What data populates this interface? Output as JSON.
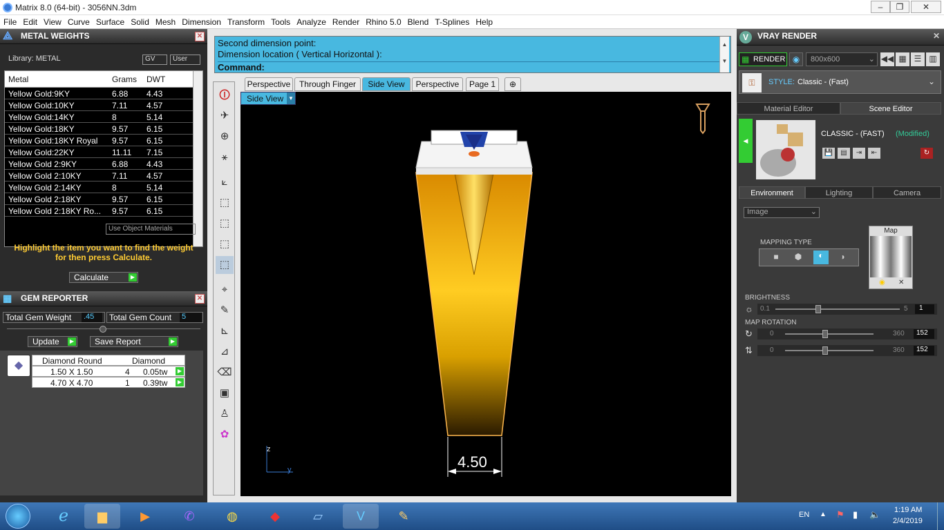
{
  "window": {
    "title": "Matrix 8.0 (64-bit) - 3056NN.3dm"
  },
  "menu": [
    "File",
    "Edit",
    "View",
    "Curve",
    "Surface",
    "Solid",
    "Mesh",
    "Dimension",
    "Transform",
    "Tools",
    "Analyze",
    "Render",
    "Rhino 5.0",
    "Blend",
    "T-Splines",
    "Help"
  ],
  "metal": {
    "title": "METAL WEIGHTS",
    "library": "Library: METAL",
    "gv": "GV",
    "user": "User",
    "headers": [
      "Metal",
      "Grams",
      "DWT"
    ],
    "rows": [
      [
        "Yellow Gold:9KY",
        "6.88",
        "4.43"
      ],
      [
        "Yellow Gold:10KY",
        "7.11",
        "4.57"
      ],
      [
        "Yellow Gold:14KY",
        "8",
        "5.14"
      ],
      [
        "Yellow Gold:18KY",
        "9.57",
        "6.15"
      ],
      [
        "Yellow Gold:18KY Royal",
        "9.57",
        "6.15"
      ],
      [
        "Yellow Gold:22KY",
        "11.11",
        "7.15"
      ],
      [
        "Yellow Gold 2:9KY",
        "6.88",
        "4.43"
      ],
      [
        "Yellow Gold 2:10KY",
        "7.11",
        "4.57"
      ],
      [
        "Yellow Gold 2:14KY",
        "8",
        "5.14"
      ],
      [
        "Yellow Gold 2:18KY",
        "9.57",
        "6.15"
      ],
      [
        "Yellow Gold 2:18KY Ro...",
        "9.57",
        "6.15"
      ]
    ],
    "use_object": "Use Object Materials",
    "hint": "Highlight the item you want to find the weight for then press Calculate.",
    "calculate": "Calculate"
  },
  "gem": {
    "title": "GEM REPORTER",
    "total_weight_label": "Total Gem Weight",
    "total_weight": ".45",
    "total_count_label": "Total Gem Count",
    "total_count": "5",
    "update": "Update",
    "save_report": "Save Report",
    "headers": [
      "Diamond Round",
      "Diamond"
    ],
    "rows": [
      [
        "1.50 X 1.50",
        "4",
        "0.05tw"
      ],
      [
        "4.70 X 4.70",
        "1",
        "0.39tw"
      ]
    ]
  },
  "command": {
    "line1": "Second dimension point:",
    "line2": "Dimension location ( Vertical  Horizontal ):",
    "prompt": "Command:"
  },
  "viewtabs": [
    "Perspective",
    "Through Finger",
    "Side View",
    "Perspective",
    "Page 1"
  ],
  "viewport": {
    "label": "Side View",
    "dimension": "4.50",
    "axis_z": "z",
    "axis_y": "y"
  },
  "vray": {
    "title": "VRAY RENDER",
    "render": "RENDER",
    "resolution": "800x600",
    "style_label": "STYLE:",
    "style_value": "Classic - (Fast)",
    "tabs": [
      "Material Editor",
      "Scene Editor"
    ],
    "preset": "CLASSIC - (FAST)",
    "modified": "(Modified)",
    "env_tabs": [
      "Environment",
      "Lighting",
      "Camera"
    ],
    "env_type": "Image",
    "mapping_type": "MAPPING TYPE",
    "map": "Map",
    "brightness": "BRIGHTNESS",
    "b_min": "0.1",
    "b_max": "5",
    "b_val": "1",
    "b_level": 0.32,
    "map_rotation": "MAP ROTATION",
    "r_min": "0",
    "r_max": "360",
    "r1_val": "152",
    "r2_val": "152",
    "r_level": 0.42
  },
  "taskbar": {
    "lang": "EN",
    "time": "1:19 AM",
    "date": "2/4/2019"
  }
}
